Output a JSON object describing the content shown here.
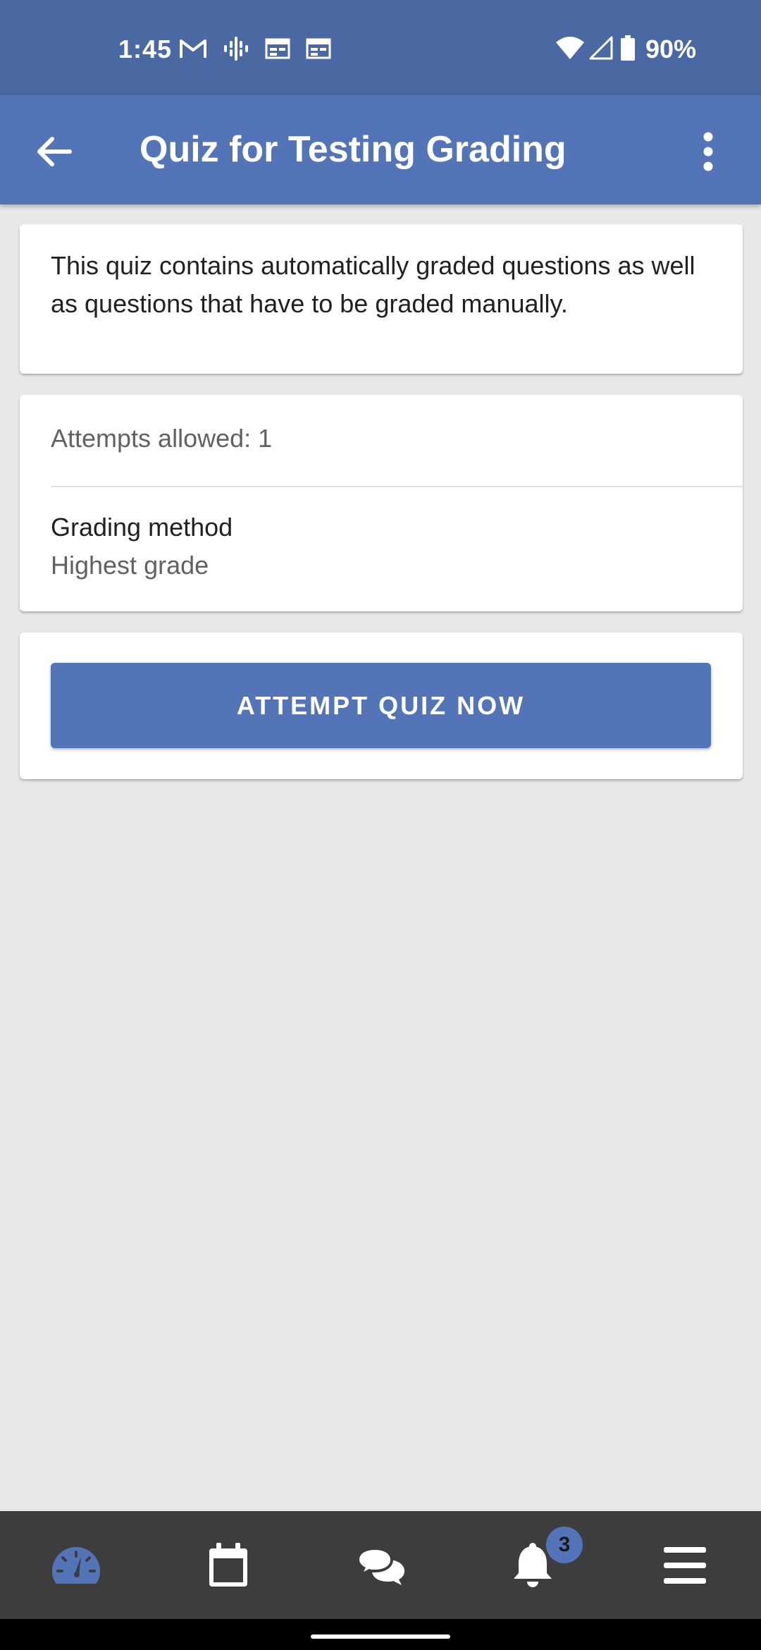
{
  "status_bar": {
    "time": "1:45",
    "battery_percent": "90%",
    "icons": [
      "gmail-icon",
      "podcast-icon",
      "calendar-icon",
      "calendar-icon",
      "wifi-icon",
      "signal-icon",
      "battery-icon"
    ]
  },
  "app_bar": {
    "title": "Quiz for Testing Grading",
    "back_icon": "arrow-back-icon",
    "menu_icon": "more-vertical-icon"
  },
  "quiz": {
    "description": "This quiz contains automatically graded questions as well as questions that have to be graded manually.",
    "attempts_allowed": "Attempts allowed: 1",
    "grading_method_label": "Grading method",
    "grading_method_value": "Highest grade",
    "attempt_button_label": "ATTEMPT QUIZ NOW"
  },
  "bottom_nav": {
    "items": [
      {
        "icon": "dashboard-icon",
        "active": true
      },
      {
        "icon": "calendar-icon",
        "active": false
      },
      {
        "icon": "messages-icon",
        "active": false
      },
      {
        "icon": "notifications-icon",
        "active": false,
        "badge": "3"
      },
      {
        "icon": "menu-icon",
        "active": false
      }
    ]
  },
  "colors": {
    "status_bar": "#4a69a3",
    "app_bar": "#5474b8",
    "background": "#e8e8e8",
    "bottom_nav": "#3d3d3d",
    "accent": "#5474b8"
  }
}
